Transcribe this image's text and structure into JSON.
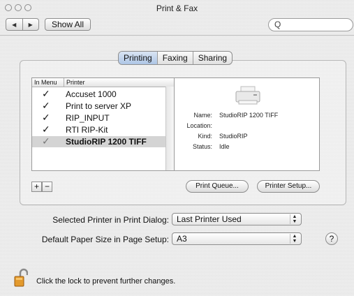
{
  "window": {
    "title": "Print & Fax"
  },
  "toolbar": {
    "show_all_label": "Show All",
    "search_icon": "Q"
  },
  "tabs": [
    {
      "label": "Printing",
      "active": true
    },
    {
      "label": "Faxing",
      "active": false
    },
    {
      "label": "Sharing",
      "active": false
    }
  ],
  "printer_list": {
    "col_in_menu": "In Menu",
    "col_printer": "Printer",
    "rows": [
      {
        "name": "Accuset 1000",
        "checked": true,
        "selected": false
      },
      {
        "name": "Print to server XP",
        "checked": true,
        "selected": false
      },
      {
        "name": "RIP_INPUT",
        "checked": true,
        "selected": false
      },
      {
        "name": "RTI RIP-Kit",
        "checked": true,
        "selected": false
      },
      {
        "name": "StudioRIP 1200 TIFF",
        "checked": true,
        "selected": true
      }
    ]
  },
  "details": {
    "name_label": "Name:",
    "name_value": "StudioRIP 1200 TIFF",
    "location_label": "Location:",
    "location_value": "",
    "kind_label": "Kind:",
    "kind_value": "StudioRIP",
    "status_label": "Status:",
    "status_value": "Idle"
  },
  "buttons": {
    "add": "+",
    "remove": "−",
    "print_queue": "Print Queue...",
    "printer_setup": "Printer Setup..."
  },
  "settings": {
    "selected_printer_label": "Selected Printer in Print Dialog:",
    "selected_printer_value": "Last Printer Used",
    "paper_size_label": "Default Paper Size in Page Setup:",
    "paper_size_value": "A3"
  },
  "help": "?",
  "lock": {
    "text": "Click the lock to prevent further changes."
  },
  "colors": {
    "selection": "#d4d4d4",
    "tab_active": "#aec6e6"
  }
}
